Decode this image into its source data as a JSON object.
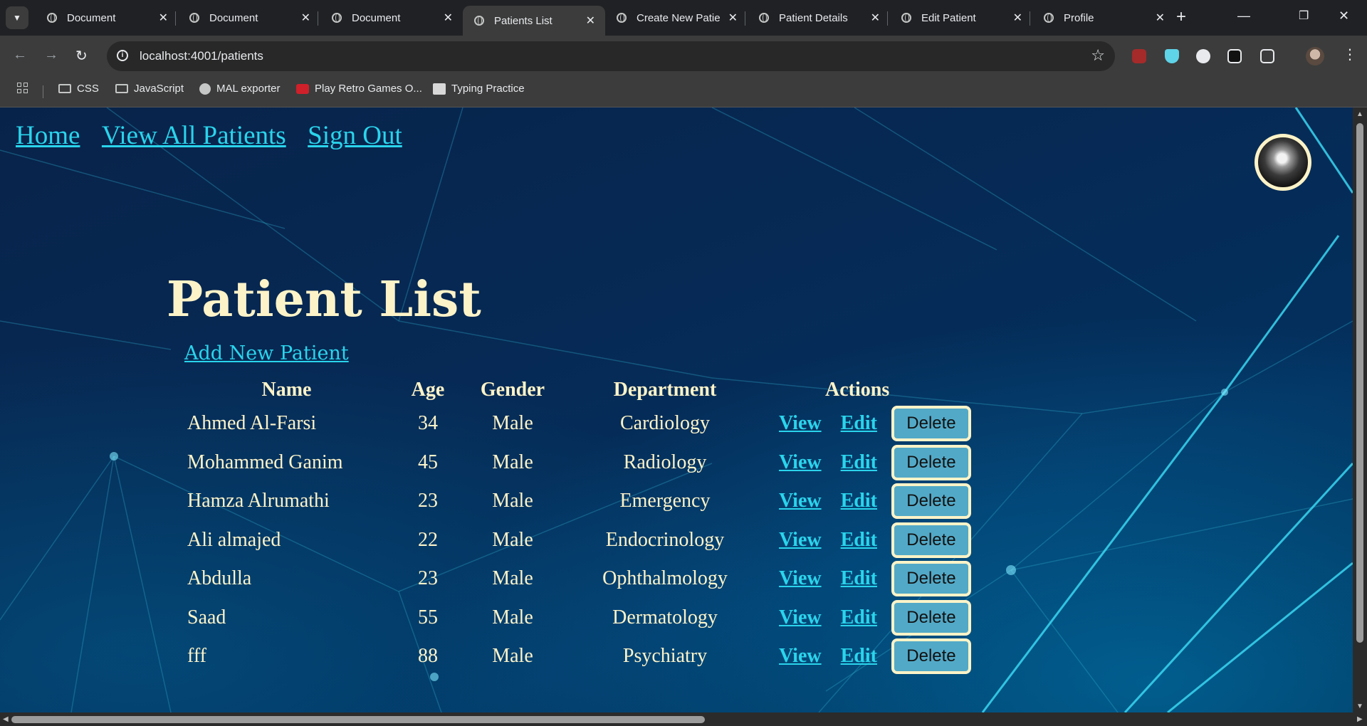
{
  "browser": {
    "tabs": [
      {
        "title": "Document",
        "active": false
      },
      {
        "title": "Document",
        "active": false
      },
      {
        "title": "Document",
        "active": false
      },
      {
        "title": "Patients List",
        "active": true
      },
      {
        "title": "Create New Patie",
        "active": false
      },
      {
        "title": "Patient Details",
        "active": false
      },
      {
        "title": "Edit Patient",
        "active": false
      },
      {
        "title": "Profile",
        "active": false
      }
    ],
    "url": "localhost:4001/patients",
    "bookmarks": [
      {
        "label": "CSS",
        "icon": "folder-icon"
      },
      {
        "label": "JavaScript",
        "icon": "folder-icon"
      },
      {
        "label": "MAL exporter",
        "icon": "globe-icon"
      },
      {
        "label": "Play Retro Games O...",
        "icon": "retro-games-icon"
      },
      {
        "label": "Typing Practice",
        "icon": "typing-practice-icon"
      }
    ]
  },
  "nav": {
    "home": "Home",
    "view_all": "View All Patients",
    "sign_out": "Sign Out"
  },
  "page": {
    "title": "Patient List",
    "add_link": "Add New Patient"
  },
  "table": {
    "headers": {
      "name": "Name",
      "age": "Age",
      "gender": "Gender",
      "department": "Department",
      "actions": "Actions"
    },
    "view_label": "View",
    "edit_label": "Edit",
    "delete_label": "Delete",
    "rows": [
      {
        "name": "Ahmed Al-Farsi",
        "age": "34",
        "gender": "Male",
        "department": "Cardiology"
      },
      {
        "name": "Mohammed Ganim",
        "age": "45",
        "gender": "Male",
        "department": "Radiology"
      },
      {
        "name": "Hamza Alrumathi",
        "age": "23",
        "gender": "Male",
        "department": "Emergency"
      },
      {
        "name": "Ali almajed",
        "age": "22",
        "gender": "Male",
        "department": "Endocrinology"
      },
      {
        "name": "Abdulla",
        "age": "23",
        "gender": "Male",
        "department": "Ophthalmology"
      },
      {
        "name": "Saad",
        "age": "55",
        "gender": "Male",
        "department": "Dermatology"
      },
      {
        "name": "fff",
        "age": "88",
        "gender": "Male",
        "department": "Psychiatry"
      }
    ]
  },
  "colors": {
    "link": "#2ad4ec",
    "text": "#fdf3c8",
    "delete_button": "#52a9c7",
    "background": "#062a55"
  }
}
